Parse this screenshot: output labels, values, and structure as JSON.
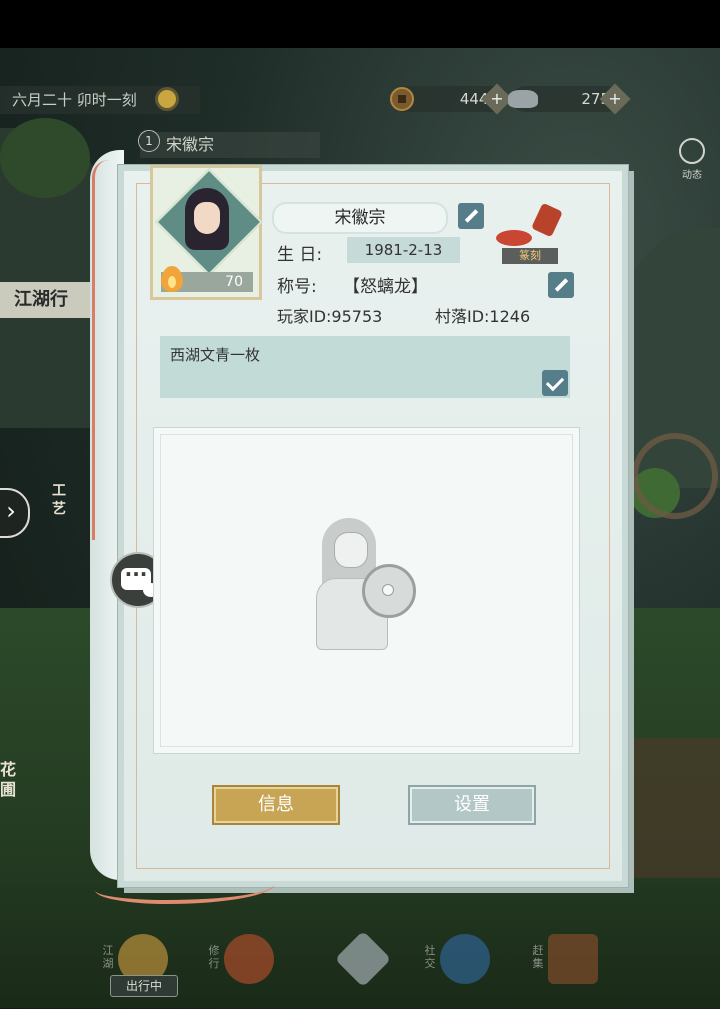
{
  "hud": {
    "date_time": "六月二十 卯时一刻",
    "copper": "4446",
    "silver": "275",
    "player_name": "宋徽宗",
    "player_level": "1",
    "activity": "动态"
  },
  "side": {
    "jianghu": "江湖行",
    "crafts": "工艺",
    "garden": "花圃"
  },
  "profile": {
    "name": "宋徽宗",
    "level": "70",
    "birthday_label": "生  日:",
    "birthday": "1981-2-13",
    "title_label": "称号:",
    "title": "【怒螭龙】",
    "player_id": "玩家ID:95753",
    "village_id": "村落ID:1246",
    "signature": "西湖文青一枚",
    "seal_label": "篆刻"
  },
  "buttons": {
    "info": "信息",
    "settings": "设置"
  },
  "bottom_nav": {
    "items": [
      "江湖",
      "修行",
      "社交",
      "赶集"
    ],
    "status": "出行中"
  },
  "colors": {
    "info_button": "#c8a555",
    "settings_button": "#b4c7c7",
    "edit_button": "#557d8a",
    "signature_bg": "#c3dbd6"
  }
}
